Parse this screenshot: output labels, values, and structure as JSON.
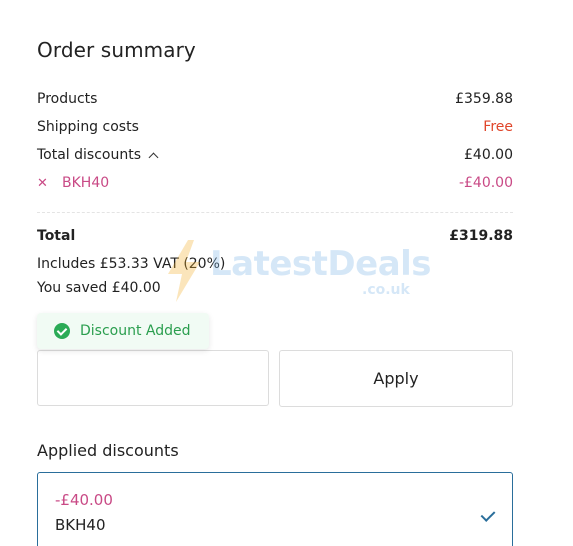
{
  "summary": {
    "title": "Order summary",
    "products_label": "Products",
    "products_value": "£359.88",
    "shipping_label": "Shipping costs",
    "shipping_value": "Free",
    "discounts_label": "Total discounts",
    "discounts_value": "£40.00",
    "discount_code": "BKH40",
    "discount_code_value": "-£40.00",
    "total_label": "Total",
    "total_value": "£319.88",
    "vat_text": "Includes £53.33 VAT (20%)",
    "saved_text": "You saved £40.00"
  },
  "watermark": {
    "text": "LatestDeals",
    "sub": ".co.uk"
  },
  "toast": {
    "text": "Discount Added"
  },
  "promo": {
    "input_value": "",
    "apply_label": "Apply"
  },
  "applied": {
    "title": "Applied discounts",
    "amount": "-£40.00",
    "code": "BKH40"
  },
  "colors": {
    "free": "#e0452a",
    "discount": "#c94a86",
    "success": "#2bab56",
    "selected_border": "#2a6e9b"
  },
  "icons": {
    "collapse": "chevron-up-icon",
    "remove": "close-icon",
    "toast": "check-circle-icon",
    "selected": "check-icon"
  }
}
